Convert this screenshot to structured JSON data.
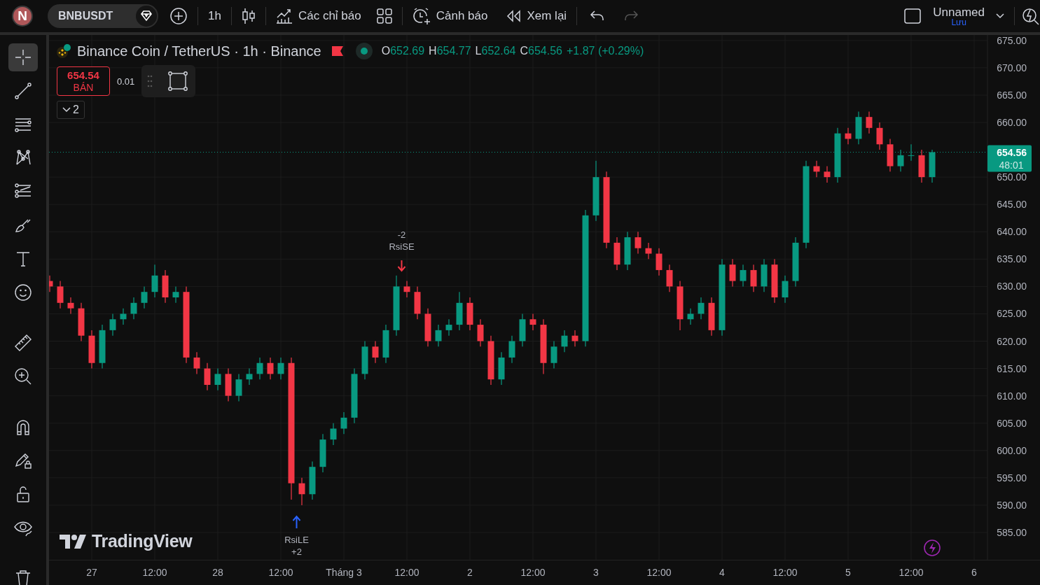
{
  "top_bar": {
    "avatar": "N",
    "symbol": "BNBUSDT",
    "interval": "1h",
    "indicators": "Các chỉ báo",
    "alerts": "Cảnh báo",
    "replay": "Xem lại",
    "redo": {
      "disabled": true
    },
    "layout_name": "Unnamed",
    "save_label": "Lưu"
  },
  "left_toolbar": {
    "groups": [
      {
        "tools": [
          {
            "kind": "crosshair",
            "selected": true
          },
          {
            "kind": "trend-line",
            "selected": false
          },
          {
            "kind": "fib",
            "selected": false
          },
          {
            "kind": "pattern",
            "selected": false
          },
          {
            "kind": "forecast",
            "selected": false
          },
          {
            "kind": "brush",
            "selected": false
          },
          {
            "kind": "text",
            "selected": false
          },
          {
            "kind": "emoji",
            "selected": false
          }
        ]
      },
      {
        "tools": [
          {
            "kind": "ruler",
            "selected": false
          },
          {
            "kind": "zoom",
            "selected": false
          }
        ]
      },
      {
        "tools": [
          {
            "kind": "magnet",
            "selected": false
          },
          {
            "kind": "draw-lock",
            "selected": false
          },
          {
            "kind": "lock",
            "selected": false
          },
          {
            "kind": "eye",
            "selected": false
          }
        ]
      },
      {
        "tools": [
          {
            "kind": "trash",
            "selected": false
          }
        ]
      }
    ]
  },
  "legend": {
    "title": "Binance Coin / TetherUS · 1h · Binance",
    "ohlc": [
      {
        "label": "O",
        "value": "652.69"
      },
      {
        "label": "H",
        "value": "654.77"
      },
      {
        "label": "L",
        "value": "652.64"
      },
      {
        "label": "C",
        "value": "654.56"
      }
    ],
    "change": "+1.87 (+0.29%)"
  },
  "order": {
    "price": "654.54",
    "action": "BÁN",
    "lot": "0.01"
  },
  "collapse": {
    "count": "2"
  },
  "brand": "TradingView",
  "chart": {
    "countdown": "48:01",
    "chart_data": {
      "type": "candlestick",
      "grid": true,
      "categories": [
        null,
        null,
        null,
        null,
        "27",
        null,
        null,
        null,
        null,
        null,
        "12:00",
        null,
        null,
        null,
        null,
        null,
        "28",
        null,
        null,
        null,
        null,
        null,
        "12:00",
        null,
        null,
        null,
        null,
        null,
        "Tháng 3",
        null,
        null,
        null,
        null,
        null,
        "12:00",
        null,
        null,
        null,
        null,
        null,
        "2",
        null,
        null,
        null,
        null,
        null,
        "12:00",
        null,
        null,
        null,
        null,
        null,
        "3",
        null,
        null,
        null,
        null,
        null,
        "12:00",
        null,
        null,
        null,
        null,
        null,
        "4",
        null,
        null,
        null,
        null,
        null,
        "12:00",
        null,
        null,
        null,
        null,
        null,
        "5",
        null,
        null,
        null,
        null,
        null,
        "12:00",
        null,
        null,
        null,
        null,
        null,
        "6"
      ],
      "ohlc": [
        [
          631,
          632,
          629,
          630
        ],
        [
          630,
          631,
          626,
          627
        ],
        [
          627,
          628,
          625,
          626
        ],
        [
          626,
          627,
          620,
          621
        ],
        [
          621,
          622,
          615,
          616
        ],
        [
          616,
          623,
          615,
          622
        ],
        [
          622,
          625,
          621,
          624
        ],
        [
          624,
          626,
          623,
          625
        ],
        [
          625,
          628,
          624,
          627
        ],
        [
          627,
          630,
          626,
          629
        ],
        [
          629,
          634,
          628,
          632
        ],
        [
          632,
          633,
          627,
          628
        ],
        [
          628,
          630,
          627,
          629
        ],
        [
          629,
          630,
          616,
          617
        ],
        [
          617,
          618,
          614,
          615
        ],
        [
          615,
          616,
          611,
          612
        ],
        [
          612,
          615,
          611,
          614
        ],
        [
          614,
          615,
          609,
          610
        ],
        [
          610,
          614,
          609,
          613
        ],
        [
          613,
          615,
          612,
          614
        ],
        [
          614,
          617,
          613,
          616
        ],
        [
          616,
          617,
          613,
          614
        ],
        [
          614,
          617,
          613,
          616
        ],
        [
          616,
          617,
          591,
          594
        ],
        [
          594,
          595,
          590,
          592
        ],
        [
          592,
          598,
          591,
          597
        ],
        [
          597,
          603,
          596,
          602
        ],
        [
          602,
          605,
          601,
          604
        ],
        [
          604,
          607,
          603,
          606
        ],
        [
          606,
          615,
          605,
          614
        ],
        [
          614,
          620,
          613,
          619
        ],
        [
          619,
          620,
          616,
          617
        ],
        [
          617,
          623,
          616,
          622
        ],
        [
          622,
          632,
          621,
          630
        ],
        [
          630,
          631,
          628,
          629
        ],
        [
          629,
          630,
          624,
          625
        ],
        [
          625,
          626,
          619,
          620
        ],
        [
          620,
          623,
          619,
          622
        ],
        [
          622,
          624,
          621,
          623
        ],
        [
          623,
          629,
          622,
          627
        ],
        [
          627,
          628,
          622,
          623
        ],
        [
          623,
          624,
          619,
          620
        ],
        [
          620,
          621,
          612,
          613
        ],
        [
          613,
          618,
          612,
          617
        ],
        [
          617,
          621,
          616,
          620
        ],
        [
          620,
          625,
          619,
          624
        ],
        [
          624,
          625,
          622,
          623
        ],
        [
          623,
          624,
          614,
          616
        ],
        [
          616,
          620,
          615,
          619
        ],
        [
          619,
          622,
          618,
          621
        ],
        [
          621,
          622,
          619,
          620
        ],
        [
          620,
          644,
          619,
          643
        ],
        [
          643,
          653,
          642,
          650
        ],
        [
          650,
          651,
          637,
          638
        ],
        [
          638,
          639,
          633,
          634
        ],
        [
          634,
          640,
          633,
          639
        ],
        [
          639,
          640,
          636,
          637
        ],
        [
          637,
          638,
          635,
          636
        ],
        [
          636,
          637,
          632,
          633
        ],
        [
          633,
          634,
          629,
          630
        ],
        [
          630,
          631,
          622,
          624
        ],
        [
          624,
          626,
          623,
          625
        ],
        [
          625,
          628,
          624,
          627
        ],
        [
          627,
          628,
          621,
          622
        ],
        [
          622,
          635,
          621,
          634
        ],
        [
          634,
          635,
          630,
          631
        ],
        [
          631,
          634,
          630,
          633
        ],
        [
          633,
          634,
          629,
          630
        ],
        [
          630,
          635,
          629,
          634
        ],
        [
          634,
          635,
          627,
          628
        ],
        [
          628,
          632,
          627,
          631
        ],
        [
          631,
          639,
          630,
          638
        ],
        [
          638,
          653,
          637,
          652
        ],
        [
          652,
          653,
          650,
          651
        ],
        [
          651,
          652,
          649,
          650
        ],
        [
          650,
          659,
          649,
          658
        ],
        [
          658,
          659,
          656,
          657
        ],
        [
          657,
          662,
          656,
          661
        ],
        [
          661,
          662,
          658,
          659
        ],
        [
          659,
          660,
          655,
          656
        ],
        [
          656,
          657,
          651,
          652
        ],
        [
          652,
          655,
          651,
          654
        ],
        [
          654,
          656,
          653,
          654
        ],
        [
          654,
          655,
          649,
          650
        ],
        [
          650,
          655,
          649,
          654.56
        ],
        null,
        null,
        null,
        null
      ],
      "ylim": [
        580,
        676
      ],
      "yticks": [
        {
          "value": 675,
          "label": "675.00"
        },
        {
          "value": 670,
          "label": "670.00"
        },
        {
          "value": 665,
          "label": "665.00"
        },
        {
          "value": 660,
          "label": "660.00"
        },
        {
          "value": 650,
          "label": "650.00"
        },
        {
          "value": 645,
          "label": "645.00"
        },
        {
          "value": 640,
          "label": "640.00"
        },
        {
          "value": 635,
          "label": "635.00"
        },
        {
          "value": 630,
          "label": "630.00"
        },
        {
          "value": 625,
          "label": "625.00"
        },
        {
          "value": 620,
          "label": "620.00"
        },
        {
          "value": 615,
          "label": "615.00"
        },
        {
          "value": 610,
          "label": "610.00"
        },
        {
          "value": 605,
          "label": "605.00"
        },
        {
          "value": 600,
          "label": "600.00"
        },
        {
          "value": 595,
          "label": "595.00"
        },
        {
          "value": 590,
          "label": "590.00"
        },
        {
          "value": 585,
          "label": "585.00"
        }
      ],
      "ref_lines": [
        {
          "axis": "y",
          "value": 654.56,
          "label": "654.56"
        }
      ],
      "annotations": [
        "-2",
        "RsiSE",
        "RsiLE",
        "+2"
      ]
    }
  }
}
